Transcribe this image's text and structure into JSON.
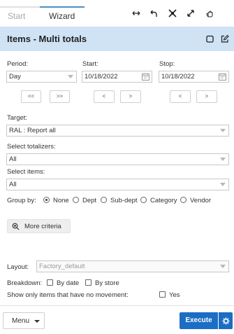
{
  "tabs": [
    {
      "label": "Start",
      "active": false
    },
    {
      "label": "Wizard",
      "active": true
    }
  ],
  "toolbar_icons": [
    "resize-horizontal-icon",
    "undo-icon",
    "collapse-icon",
    "expand-icon",
    "hand-icon"
  ],
  "header": {
    "title": "Items - Multi totals",
    "icons": [
      "window-icon",
      "edit-icon"
    ]
  },
  "period": {
    "label": "Period:",
    "value": "Day"
  },
  "start": {
    "label": "Start:",
    "value": "10/18/2022"
  },
  "stop": {
    "label": "Stop:",
    "value": "10/18/2022"
  },
  "nav": {
    "fast_back": "<<",
    "fast_forward": ">>",
    "back": "<",
    "forward": ">"
  },
  "target": {
    "label": "Target:",
    "value": "RAL : Report all"
  },
  "totalizers": {
    "label": "Select totalizers:",
    "value": "All"
  },
  "items": {
    "label": "Select items:",
    "value": "All"
  },
  "group_by": {
    "label": "Group by:",
    "options": [
      "None",
      "Dept",
      "Sub-dept",
      "Category",
      "Vendor"
    ],
    "selected": "None"
  },
  "more_criteria": {
    "label": "More criteria",
    "icon": "zoom-icon"
  },
  "layout": {
    "label": "Layout:",
    "value": "Factory_default"
  },
  "breakdown": {
    "label": "Breakdown:",
    "options": [
      {
        "label": "By date",
        "checked": false
      },
      {
        "label": "By store",
        "checked": false
      }
    ]
  },
  "no_movement": {
    "label": "Show only items that have no movement:",
    "option": "Yes",
    "checked": false
  },
  "footer": {
    "menu_label": "Menu",
    "execute_label": "Execute"
  },
  "colors": {
    "header_bg": "#cfe3f5",
    "accent": "#1c6dc4",
    "tab_active_line": "#4a90c2"
  }
}
